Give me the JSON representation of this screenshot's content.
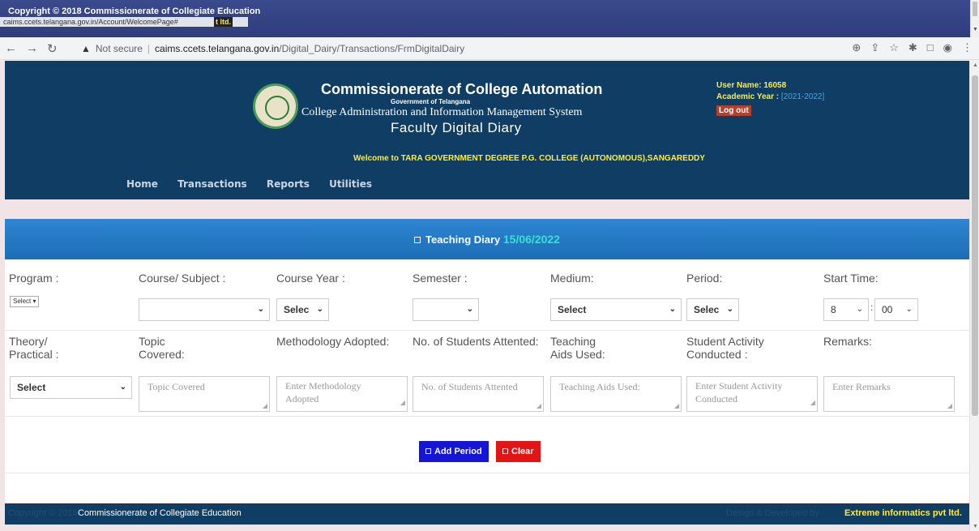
{
  "overlay": {
    "copyright": "Copyright © 2018 Commissionerate of Collegiate Education",
    "status_url": "caims.ccets.telangana.gov.in/Account/WelcomePage#",
    "highlight": "t ltd."
  },
  "browser": {
    "not_secure": "Not secure",
    "host": "caims.ccets.telangana.gov.in",
    "path": "/Digital_Dairy/Transactions/FrmDigitalDairy"
  },
  "header": {
    "title": "Commissionerate of College Automation",
    "gov": "Government of Telangana",
    "system": "College Administration and Information Management System",
    "module": "Faculty Digital Diary",
    "user_label": "User Name:",
    "user_value": "16058",
    "year_label": "Academic Year :",
    "year_value": "[2021-2022]",
    "logout": "Log out",
    "welcome_prefix": "Welcome to",
    "college": "TARA GOVERNMENT DEGREE P.G. COLLEGE (AUTONOMOUS),SANGAREDDY"
  },
  "menu": [
    "Home",
    "Transactions",
    "Reports",
    "Utilities"
  ],
  "panel": {
    "title": "Teaching Diary",
    "date": "15/06/2022"
  },
  "row1": {
    "program": "Program",
    "course": "Course/ Subject",
    "course_year": "Course Year",
    "semester": "Semester",
    "medium": "Medium:",
    "period": "Period:",
    "start_time": "Start Time:"
  },
  "row1_controls": {
    "program": "Select",
    "course": "",
    "course_year": "Selec",
    "semester": "",
    "medium": "Select",
    "period": "Selec",
    "hour": "8",
    "minute": "00"
  },
  "row2": {
    "theory_line1": "Theory/",
    "theory_line2": "Practical",
    "topic_line1": "Topic",
    "topic_line2": "Covered:",
    "methodology": "Methodology Adopted:",
    "students": "No. of Students Attented:",
    "aids_line1": "Teaching",
    "aids_line2": "Aids Used:",
    "activity_line1": "Student Activity",
    "activity_line2": "Conducted",
    "remarks": "Remarks:"
  },
  "row2_controls": {
    "theory": "Select",
    "topic_ph": "Topic Covered",
    "methodology_ph_1": "Enter Methodology",
    "methodology_ph_2": "Adopted",
    "students_ph": "No. of Students Attented",
    "aids_ph": "Teaching Aids Used:",
    "activity_ph_1": "Enter Student Activity",
    "activity_ph_2": "Conducted",
    "remarks_ph": "Enter Remarks"
  },
  "buttons": {
    "add": "Add Period",
    "clear": "Clear"
  },
  "footer": {
    "faint_left": "Copyright © 2018",
    "left": "Commissionerate of Collegiate Education",
    "faint_right": "Design & Developed by",
    "right": "Extreme informatics pvt ltd."
  }
}
